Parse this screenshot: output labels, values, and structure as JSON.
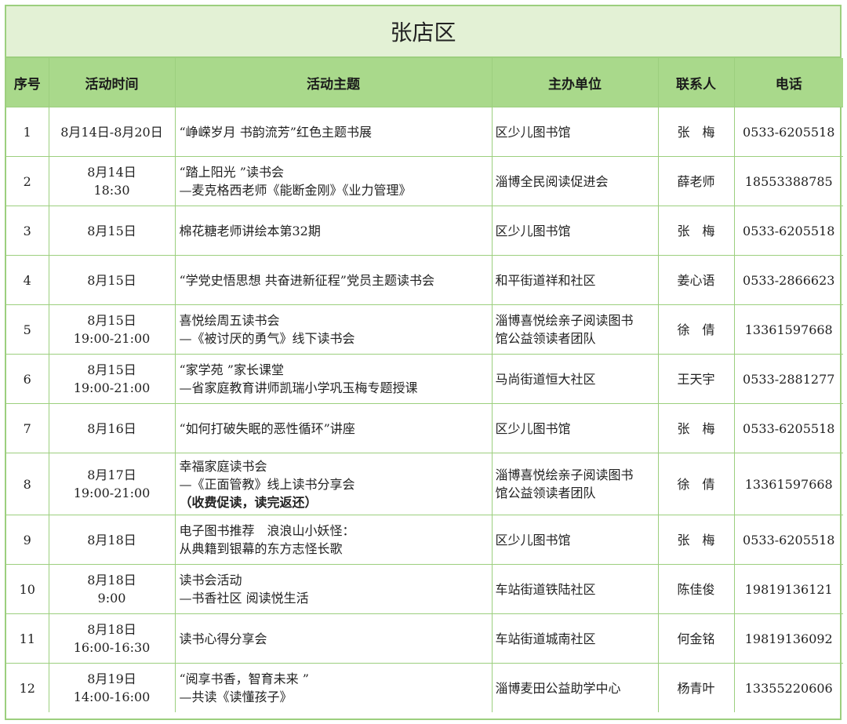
{
  "title": "张店区",
  "headers": {
    "no": "序号",
    "time": "活动时间",
    "theme": "活动主题",
    "org": "主办单位",
    "contact": "联系人",
    "phone": "电话"
  },
  "rows": [
    {
      "no": "1",
      "time": [
        "8月14日-8月20日"
      ],
      "theme": [
        "“峥嵘岁月 书韵流芳”红色主题书展"
      ],
      "org": [
        "区少儿图书馆"
      ],
      "contact": "张　梅",
      "phone": "0533-6205518"
    },
    {
      "no": "2",
      "time": [
        "8月14日",
        "18:30"
      ],
      "theme": [
        "“踏上阳光 ”读书会",
        "—麦克格西老师《能断金刚》《业力管理》"
      ],
      "org": [
        "淄博全民阅读促进会"
      ],
      "contact": "薛老师",
      "phone": "18553388785"
    },
    {
      "no": "3",
      "time": [
        "8月15日"
      ],
      "theme": [
        "棉花糖老师讲绘本第32期"
      ],
      "org": [
        "区少儿图书馆"
      ],
      "contact": "张　梅",
      "phone": "0533-6205518"
    },
    {
      "no": "4",
      "time": [
        "8月15日"
      ],
      "theme": [
        "“学党史悟思想 共奋进新征程”党员主题读书会"
      ],
      "org": [
        "和平街道祥和社区"
      ],
      "contact": "姜心语",
      "phone": "0533-2866623"
    },
    {
      "no": "5",
      "time": [
        "8月15日",
        "19:00-21:00"
      ],
      "theme": [
        "喜悦绘周五读书会",
        "—《被讨厌的勇气》线下读书会"
      ],
      "org": [
        "淄博喜悦绘亲子阅读图书",
        "馆公益领读者团队"
      ],
      "contact": "徐　倩",
      "phone": "13361597668"
    },
    {
      "no": "6",
      "time": [
        "8月15日",
        "19:00-21:00"
      ],
      "theme": [
        "“家学苑 ”家长课堂",
        "—省家庭教育讲师凯瑞小学巩玉梅专题授课"
      ],
      "org": [
        "马尚街道恒大社区"
      ],
      "contact": "王天宇",
      "phone": "0533-2881277"
    },
    {
      "no": "7",
      "time": [
        "8月16日"
      ],
      "theme": [
        "“如何打破失眠的恶性循环”讲座"
      ],
      "org": [
        "区少儿图书馆"
      ],
      "contact": "张　梅",
      "phone": "0533-6205518"
    },
    {
      "no": "8",
      "time": [
        "8月17日",
        "19:00-21:00"
      ],
      "theme": [
        "幸福家庭读书会",
        "—《正面管教》线上读书分享会",
        "（收费促读，读完返还）"
      ],
      "org": [
        "淄博喜悦绘亲子阅读图书",
        "馆公益领读者团队"
      ],
      "contact": "徐　倩",
      "phone": "13361597668"
    },
    {
      "no": "9",
      "time": [
        "8月18日"
      ],
      "theme": [
        "电子图书推荐　浪浪山小妖怪：",
        "从典籍到银幕的东方志怪长歌"
      ],
      "org": [
        "区少儿图书馆"
      ],
      "contact": "张　梅",
      "phone": "0533-6205518"
    },
    {
      "no": "10",
      "time": [
        "8月18日",
        "9:00"
      ],
      "theme": [
        "读书会活动",
        "—书香社区 阅读悦生活"
      ],
      "org": [
        "车站街道铁陆社区"
      ],
      "contact": "陈佳俊",
      "phone": "19819136121"
    },
    {
      "no": "11",
      "time": [
        "8月18日",
        "16:00-16:30"
      ],
      "theme": [
        "读书心得分享会"
      ],
      "org": [
        "车站街道城南社区"
      ],
      "contact": "何金铭",
      "phone": "19819136092"
    },
    {
      "no": "12",
      "time": [
        "8月19日",
        "14:00-16:00"
      ],
      "theme": [
        "“阅享书香，智育未来 ”",
        "—共读《读懂孩子》"
      ],
      "org": [
        "淄博麦田公益助学中心"
      ],
      "contact": "杨青叶",
      "phone": "13355220606"
    }
  ],
  "colors": {
    "border": "#9ccf7e",
    "title_bg": "#e3f1d5",
    "header_bg": "#a9d98b"
  }
}
